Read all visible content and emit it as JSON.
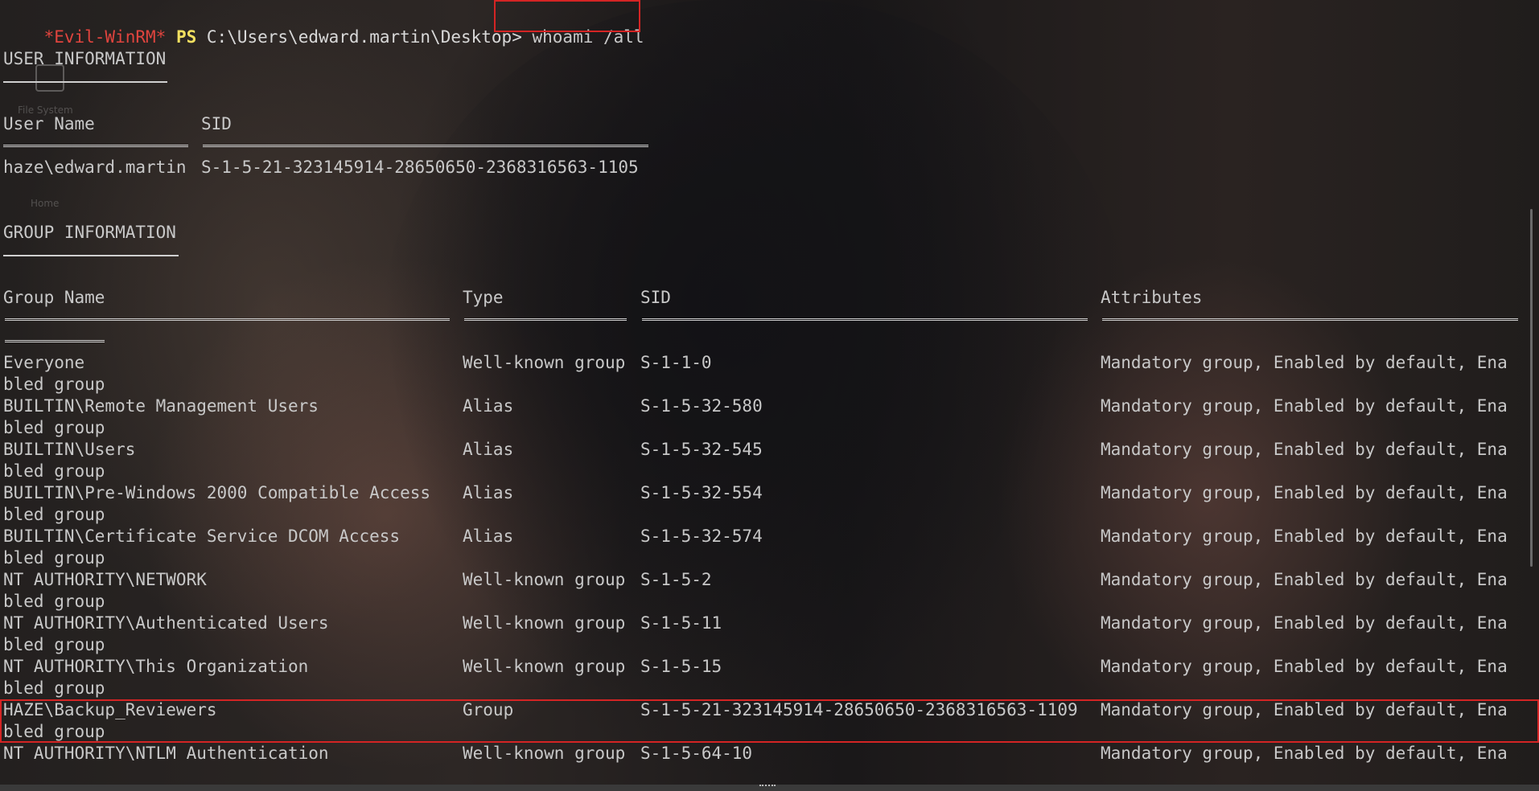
{
  "prompt": {
    "shell": "*Evil-WinRM*",
    "ps": "PS",
    "path": "C:\\Users\\edward.martin\\Desktop>",
    "command": "whoami /all"
  },
  "desktop": {
    "items": [
      {
        "label": "File System",
        "icon": "drive-icon"
      },
      {
        "label": "Home",
        "icon": "home-folder-icon"
      }
    ]
  },
  "user_info": {
    "heading": "USER INFORMATION",
    "headers": {
      "user_name": "User Name",
      "sid": "SID"
    },
    "row": {
      "user_name": "haze\\edward.martin",
      "sid": "S-1-5-21-323145914-28650650-2368316563-1105"
    }
  },
  "group_info": {
    "heading": "GROUP INFORMATION",
    "headers": {
      "group_name": "Group Name",
      "type": "Type",
      "sid": "SID",
      "attributes": "Attributes"
    },
    "attr_wrap_continuation": "bled group",
    "rows": [
      {
        "name": "Everyone",
        "type": "Well-known group",
        "sid": "S-1-1-0",
        "attributes": "Mandatory group, Enabled by default, Ena",
        "continuation": "bled group"
      },
      {
        "name": "BUILTIN\\Remote Management Users",
        "type": "Alias",
        "sid": "S-1-5-32-580",
        "attributes": "Mandatory group, Enabled by default, Ena",
        "continuation": "bled group"
      },
      {
        "name": "BUILTIN\\Users",
        "type": "Alias",
        "sid": "S-1-5-32-545",
        "attributes": "Mandatory group, Enabled by default, Ena",
        "continuation": "bled group"
      },
      {
        "name": "BUILTIN\\Pre-Windows 2000 Compatible Access",
        "type": "Alias",
        "sid": "S-1-5-32-554",
        "attributes": "Mandatory group, Enabled by default, Ena",
        "continuation": "bled group"
      },
      {
        "name": "BUILTIN\\Certificate Service DCOM Access",
        "type": "Alias",
        "sid": "S-1-5-32-574",
        "attributes": "Mandatory group, Enabled by default, Ena",
        "continuation": "bled group"
      },
      {
        "name": "NT AUTHORITY\\NETWORK",
        "type": "Well-known group",
        "sid": "S-1-5-2",
        "attributes": "Mandatory group, Enabled by default, Ena",
        "continuation": "bled group"
      },
      {
        "name": "NT AUTHORITY\\Authenticated Users",
        "type": "Well-known group",
        "sid": "S-1-5-11",
        "attributes": "Mandatory group, Enabled by default, Ena",
        "continuation": "bled group"
      },
      {
        "name": "NT AUTHORITY\\This Organization",
        "type": "Well-known group",
        "sid": "S-1-5-15",
        "attributes": "Mandatory group, Enabled by default, Ena",
        "continuation": "bled group"
      },
      {
        "name": "HAZE\\Backup_Reviewers",
        "type": "Group",
        "sid": "S-1-5-21-323145914-28650650-2368316563-1109",
        "attributes": "Mandatory group, Enabled by default, Ena",
        "continuation": "bled group",
        "highlighted": true
      },
      {
        "name": "NT AUTHORITY\\NTLM Authentication",
        "type": "Well-known group",
        "sid": "S-1-5-64-10",
        "attributes": "Mandatory group, Enabled by default, Ena",
        "continuation": ""
      }
    ]
  },
  "colors": {
    "prompt_shell": "#e0443e",
    "prompt_ps": "#f2e060",
    "text": "#c8c8c8",
    "highlight_box": "#d42424"
  }
}
